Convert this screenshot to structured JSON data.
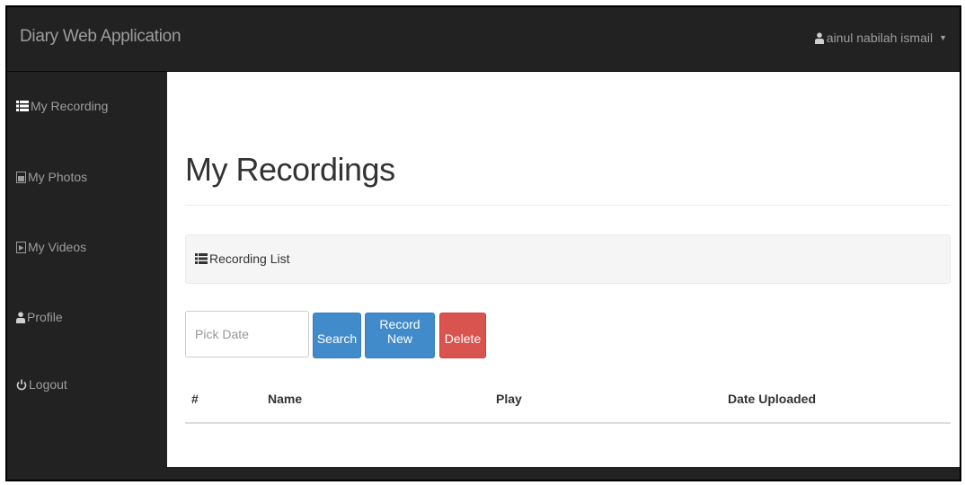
{
  "app": {
    "brand": "Diary Web Application"
  },
  "user_menu": {
    "name": "ainul nabilah ismail",
    "icon": "user-icon"
  },
  "sidebar": {
    "items": [
      {
        "label": "My Recording",
        "icon": "list-icon"
      },
      {
        "label": "My Photos",
        "icon": "file-image-icon"
      },
      {
        "label": "My Videos",
        "icon": "file-video-icon"
      },
      {
        "label": "Profile",
        "icon": "user-icon"
      },
      {
        "label": "Logout",
        "icon": "power-icon"
      }
    ]
  },
  "main": {
    "title": "My Recordings",
    "panel": {
      "label": "Recording List",
      "icon": "list-icon"
    },
    "controls": {
      "date_placeholder": "Pick Date",
      "search_label": "Search",
      "record_new_label": "Record New",
      "delete_label": "Delete"
    },
    "table": {
      "columns": [
        "#",
        "Name",
        "Play",
        "Date Uploaded"
      ],
      "rows": []
    }
  },
  "colors": {
    "navbar_bg": "#222222",
    "nav_text": "#9d9d9d",
    "primary": "#428bca",
    "danger": "#d9534f",
    "panel_bg": "#f5f5f5"
  }
}
